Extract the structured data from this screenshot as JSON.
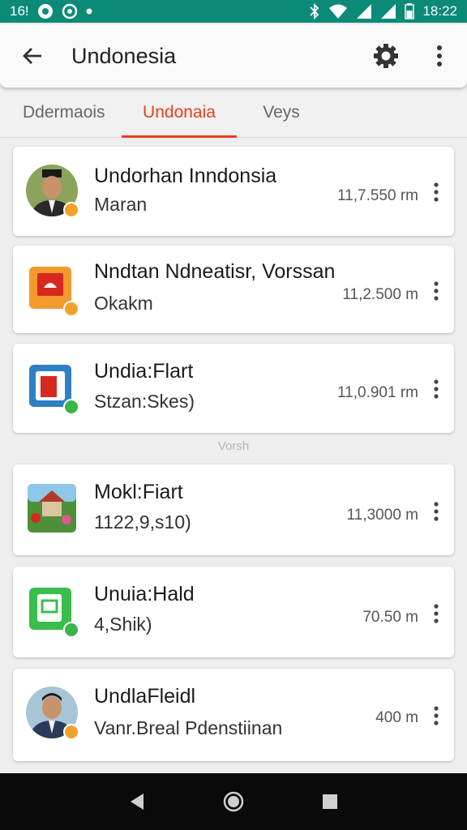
{
  "status_bar": {
    "left_text": "16!",
    "time": "18:22",
    "icons": [
      "notification-icon",
      "settings-notification-icon",
      "dot-icon",
      "bluetooth-icon",
      "wifi-icon",
      "signal-icon",
      "signal-icon",
      "battery-icon"
    ]
  },
  "app_bar": {
    "title": "Undonesia",
    "back_icon": "back-arrow-icon",
    "settings_icon": "gear-icon",
    "menu_icon": "more-vert-icon"
  },
  "tabs": [
    {
      "label": "Ddermaois",
      "active": false
    },
    {
      "label": "Undonaia",
      "active": true
    },
    {
      "label": "Veys",
      "active": false
    }
  ],
  "accent_color": "#e8401c",
  "status_color": "#0b8a78",
  "cards": [
    {
      "title": "Undorhan Inndonsia",
      "subtitle": "Maran",
      "distance": "11,7.550 rm",
      "icon": "person-avatar-icon",
      "badge_color": "#f2a12b"
    },
    {
      "title": "Nndtan Ndneatisr, Vorssan",
      "subtitle": "Okakm",
      "distance": "11,2.500 m",
      "icon": "orange-app-icon",
      "badge_color": "#f2a12b"
    },
    {
      "title": "Undia:Flart",
      "subtitle": "Stzan:Skes)",
      "distance": "11,0.901 rm",
      "icon": "blue-app-icon",
      "badge_color": "#3bb44a"
    },
    {
      "title": "Mokl:Fiart",
      "subtitle": "1122,9,s10)",
      "distance": "11,3000 m",
      "icon": "garden-photo-icon",
      "badge_color": ""
    },
    {
      "title": "Unuia:Hald",
      "subtitle": "4,Shik)",
      "distance": "70.50 m",
      "icon": "green-app-icon",
      "badge_color": "#3bb44a"
    },
    {
      "title": "UndlaFleidl",
      "subtitle": "Vanr.Breal Pdenstiinan",
      "distance": "400 m",
      "icon": "person-avatar-icon",
      "badge_color": "#f2a12b"
    }
  ],
  "section_label": "Vorsh",
  "nav": {
    "back": "nav-back-icon",
    "home": "nav-home-icon",
    "recents": "nav-recents-icon"
  }
}
